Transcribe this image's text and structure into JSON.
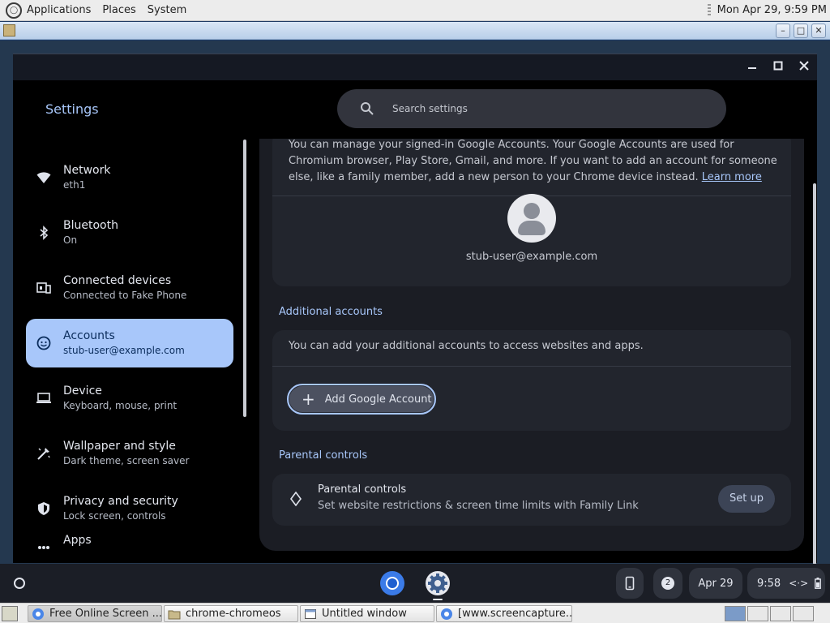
{
  "top_panel": {
    "menus": [
      "Applications",
      "Places",
      "System"
    ],
    "clock": "Mon Apr 29,  9:59 PM"
  },
  "settings": {
    "title": "Settings",
    "search": {
      "placeholder": "Search settings"
    },
    "nav": [
      {
        "label": "Network",
        "sub": "eth1",
        "icon": "wifi-icon"
      },
      {
        "label": "Bluetooth",
        "sub": "On",
        "icon": "bluetooth-icon"
      },
      {
        "label": "Connected devices",
        "sub": "Connected to Fake Phone",
        "icon": "connected-devices-icon"
      },
      {
        "label": "Accounts",
        "sub": "stub-user@example.com",
        "icon": "accounts-icon",
        "active": true
      },
      {
        "label": "Device",
        "sub": "Keyboard, mouse, print",
        "icon": "laptop-icon"
      },
      {
        "label": "Wallpaper and style",
        "sub": "Dark theme, screen saver",
        "icon": "palette-icon"
      },
      {
        "label": "Privacy and security",
        "sub": "Lock screen, controls",
        "icon": "shield-icon"
      },
      {
        "label": "Apps",
        "sub": "",
        "icon": "apps-grid-icon"
      }
    ],
    "accounts": {
      "intro_text": "You can manage your signed-in Google Accounts. Your Google Accounts are used for Chromium browser, Play Store, Gmail, and more. If you want to add an account for someone else, like a family member, add a new person to your Chrome device instead.",
      "learn_more": "Learn more",
      "email": "stub-user@example.com"
    },
    "additional": {
      "heading": "Additional accounts",
      "text": "You can add your additional accounts to access websites and apps.",
      "button": "Add Google Account"
    },
    "parental": {
      "heading": "Parental controls",
      "title": "Parental controls",
      "desc": "Set website restrictions & screen time limits with Family Link",
      "button": "Set up"
    }
  },
  "shelf": {
    "notification_count": "2",
    "date": "Apr 29",
    "time": "9:58"
  },
  "taskbar": {
    "tasks": [
      {
        "label": "Free Online Screen ...",
        "icon": "chrome-icon"
      },
      {
        "label": "chrome-chromeos",
        "icon": "folder-icon"
      },
      {
        "label": "Untitled window",
        "icon": "window-icon"
      },
      {
        "label": "[www.screencapture...",
        "icon": "chrome-icon"
      }
    ]
  },
  "colors": {
    "accent": "#a8c7fa",
    "window_bg": "#000000",
    "panel_bg": "#1b1d24",
    "card_bg": "#22252d"
  }
}
